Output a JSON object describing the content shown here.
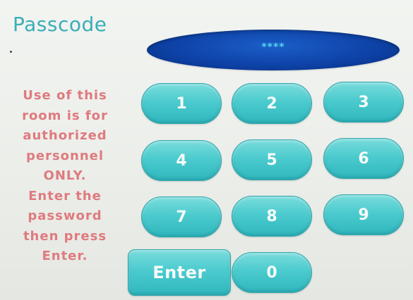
{
  "header": {
    "title": "Passcode"
  },
  "display": {
    "value": "****"
  },
  "notice": {
    "lines": [
      "Use of this",
      "room is for",
      "authorized",
      "personnel",
      "ONLY.",
      "Enter the",
      "password",
      "then press",
      "Enter."
    ]
  },
  "keypad": {
    "keys": [
      "1",
      "2",
      "3",
      "4",
      "5",
      "6",
      "7",
      "8",
      "9",
      "0"
    ],
    "enter_label": "Enter"
  },
  "colors": {
    "title": "#39aeb8",
    "notice_text": "#df7a7e",
    "key_fill": "#4ccbce",
    "display_fill": "#0e43a8",
    "display_text": "#55d2f0"
  }
}
